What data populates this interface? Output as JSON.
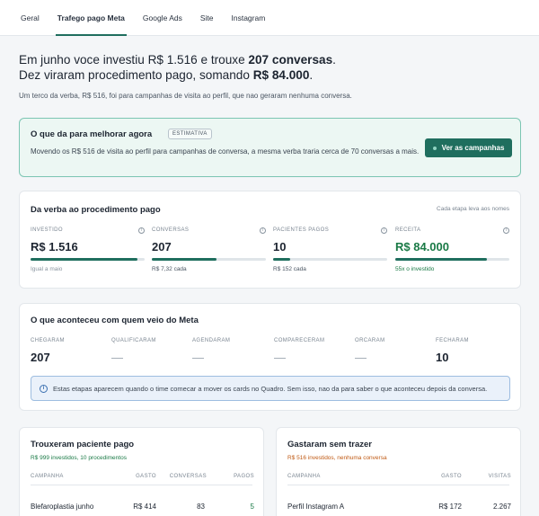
{
  "tabs": [
    {
      "label": "Geral",
      "active": false
    },
    {
      "label": "Trafego pago Meta",
      "active": true
    },
    {
      "label": "Google Ads",
      "active": false
    },
    {
      "label": "Site",
      "active": false
    },
    {
      "label": "Instagram",
      "active": false
    }
  ],
  "headline": {
    "l1_a": "Em junho voce investiu R$ 1.516 e trouxe ",
    "l1_b": "207 conversas",
    "l1_c": ".",
    "l2_a": "Dez viraram procedimento pago, somando ",
    "l2_b": "R$ 84.000",
    "l2_c": "."
  },
  "subline": "Um terco da verba, R$ 516, foi para campanhas de visita ao perfil, que nao geraram nenhuma conversa.",
  "recommendation": {
    "title": "O que da para melhorar agora",
    "badge": "ESTIMATIVA",
    "text": "Movendo os R$ 516 de visita ao perfil para campanhas de conversa, a mesma verba traria cerca de 70 conversas a mais.",
    "button": "Ver as campanhas"
  },
  "funnel": {
    "title": "Da verba ao procedimento pago",
    "note": "Cada etapa leva aos nomes",
    "metrics": [
      {
        "label": "INVESTIDO",
        "value": "R$ 1.516",
        "sub": "Igual a maio",
        "fill": 0.94,
        "value_color": "default",
        "sub_color": "gray"
      },
      {
        "label": "CONVERSAS",
        "value": "207",
        "sub": "R$ 7,32 cada",
        "fill": 0.57,
        "value_color": "default",
        "sub_color": "default"
      },
      {
        "label": "PACIENTES PAGOS",
        "value": "10",
        "sub": "R$ 152 cada",
        "fill": 0.15,
        "value_color": "default",
        "sub_color": "default"
      },
      {
        "label": "RECEITA",
        "value": "R$ 84.000",
        "sub": "55x o investido",
        "fill": 0.8,
        "value_color": "green",
        "sub_color": "green"
      }
    ]
  },
  "meta": {
    "title": "O que aconteceu com quem veio do Meta",
    "stages": [
      {
        "label": "CHEGARAM",
        "value": "207"
      },
      {
        "label": "QUALIFICARAM",
        "value": "—"
      },
      {
        "label": "AGENDARAM",
        "value": "—"
      },
      {
        "label": "COMPARECERAM",
        "value": "—"
      },
      {
        "label": "ORCARAM",
        "value": "—"
      },
      {
        "label": "FECHARAM",
        "value": "10"
      }
    ],
    "notice": "Estas etapas aparecem quando o time comecar a mover os cards no Quadro. Sem isso, nao da para saber o que aconteceu depois da conversa."
  },
  "paid_table": {
    "title": "Trouxeram paciente pago",
    "sub": "R$ 999 investidos, 10 procedimentos",
    "headers": [
      "CAMPANHA",
      "GASTO",
      "CONVERSAS",
      "PAGOS"
    ],
    "rows": [
      {
        "campaign": "Blefaroplastia junho",
        "spend": "R$ 414",
        "conversations": "83",
        "paid": "5"
      }
    ]
  },
  "wasted_table": {
    "title": "Gastaram sem trazer",
    "sub": "R$ 516 investidos, nenhuma conversa",
    "headers": [
      "CAMPANHA",
      "GASTO",
      "VISITAS"
    ],
    "rows": [
      {
        "campaign": "Perfil Instagram A",
        "spend": "R$ 172",
        "visits": "2.267"
      }
    ]
  },
  "colors": {
    "accent": "#1f6e5e",
    "positive": "#1a7a46",
    "warning": "#c05a14",
    "info": "#3a6fb0"
  }
}
